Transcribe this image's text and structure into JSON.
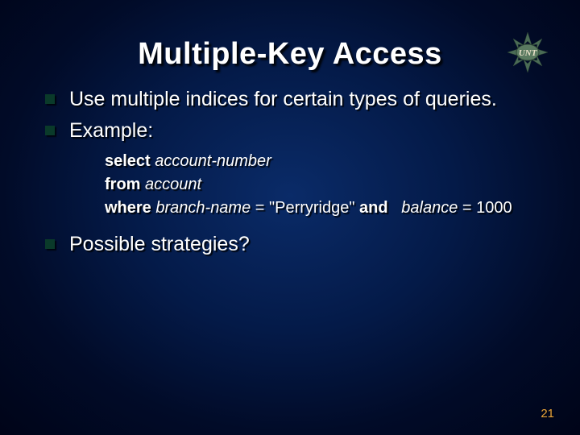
{
  "title": "Multiple-Key Access",
  "bullets": {
    "b1": "Use multiple indices for certain types of queries.",
    "b2": "Example:",
    "b3": "Possible strategies?"
  },
  "code": {
    "select_kw": "select",
    "select_ident": "account-number",
    "from_kw": "from",
    "from_ident": "account",
    "where_kw": "where",
    "where_ident1": "branch-name",
    "where_mid": " = \"Perryridge\" ",
    "and_kw": "and",
    "where_ident2": "balance",
    "where_end": " = 1000"
  },
  "page_number": "21",
  "logo_alt": "UNT"
}
